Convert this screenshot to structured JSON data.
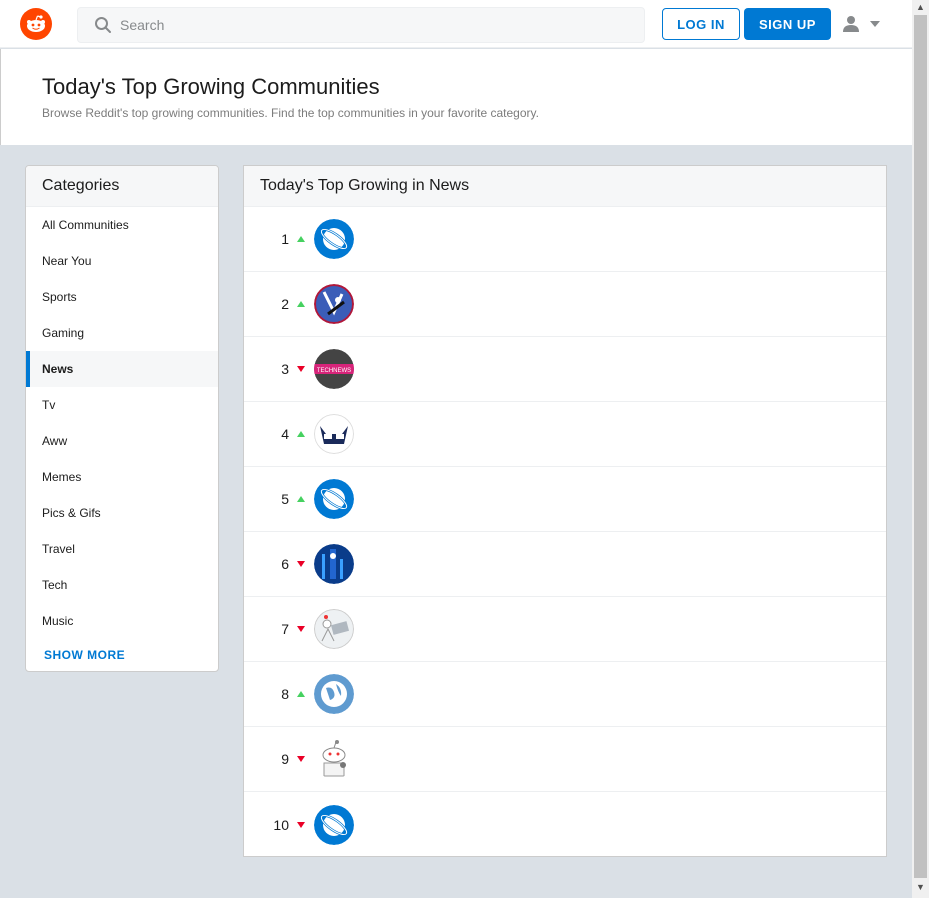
{
  "header": {
    "search_placeholder": "Search",
    "login_label": "LOG IN",
    "signup_label": "SIGN UP"
  },
  "banner": {
    "title": "Today's Top Growing Communities",
    "subtitle": "Browse Reddit's top growing communities. Find the top communities in your favorite category."
  },
  "sidebar": {
    "title": "Categories",
    "items": [
      {
        "label": "All Communities"
      },
      {
        "label": "Near You"
      },
      {
        "label": "Sports"
      },
      {
        "label": "Gaming"
      },
      {
        "label": "News",
        "active": true
      },
      {
        "label": "Tv"
      },
      {
        "label": "Aww"
      },
      {
        "label": "Memes"
      },
      {
        "label": "Pics & Gifs"
      },
      {
        "label": "Travel"
      },
      {
        "label": "Tech"
      },
      {
        "label": "Music"
      }
    ],
    "show_more": "SHOW MORE"
  },
  "main": {
    "title": "Today's Top Growing in News",
    "rows": [
      {
        "rank": "1",
        "trend": "up",
        "avatar": "planet-icon"
      },
      {
        "rank": "2",
        "trend": "up",
        "avatar": "community-logo"
      },
      {
        "rank": "3",
        "trend": "down",
        "avatar": "technews-logo"
      },
      {
        "rank": "4",
        "trend": "up",
        "avatar": "cat-logo"
      },
      {
        "rank": "5",
        "trend": "up",
        "avatar": "planet-icon"
      },
      {
        "rank": "6",
        "trend": "down",
        "avatar": "blue-abstract-logo"
      },
      {
        "rank": "7",
        "trend": "down",
        "avatar": "sketch-logo"
      },
      {
        "rank": "8",
        "trend": "up",
        "avatar": "globe-icon"
      },
      {
        "rank": "9",
        "trend": "down",
        "avatar": "snoo-icon"
      },
      {
        "rank": "10",
        "trend": "down",
        "avatar": "planet-icon"
      }
    ]
  },
  "colors": {
    "accent": "#0079d3",
    "brand": "#ff4500",
    "up": "#46d160",
    "down": "#ea0027"
  }
}
